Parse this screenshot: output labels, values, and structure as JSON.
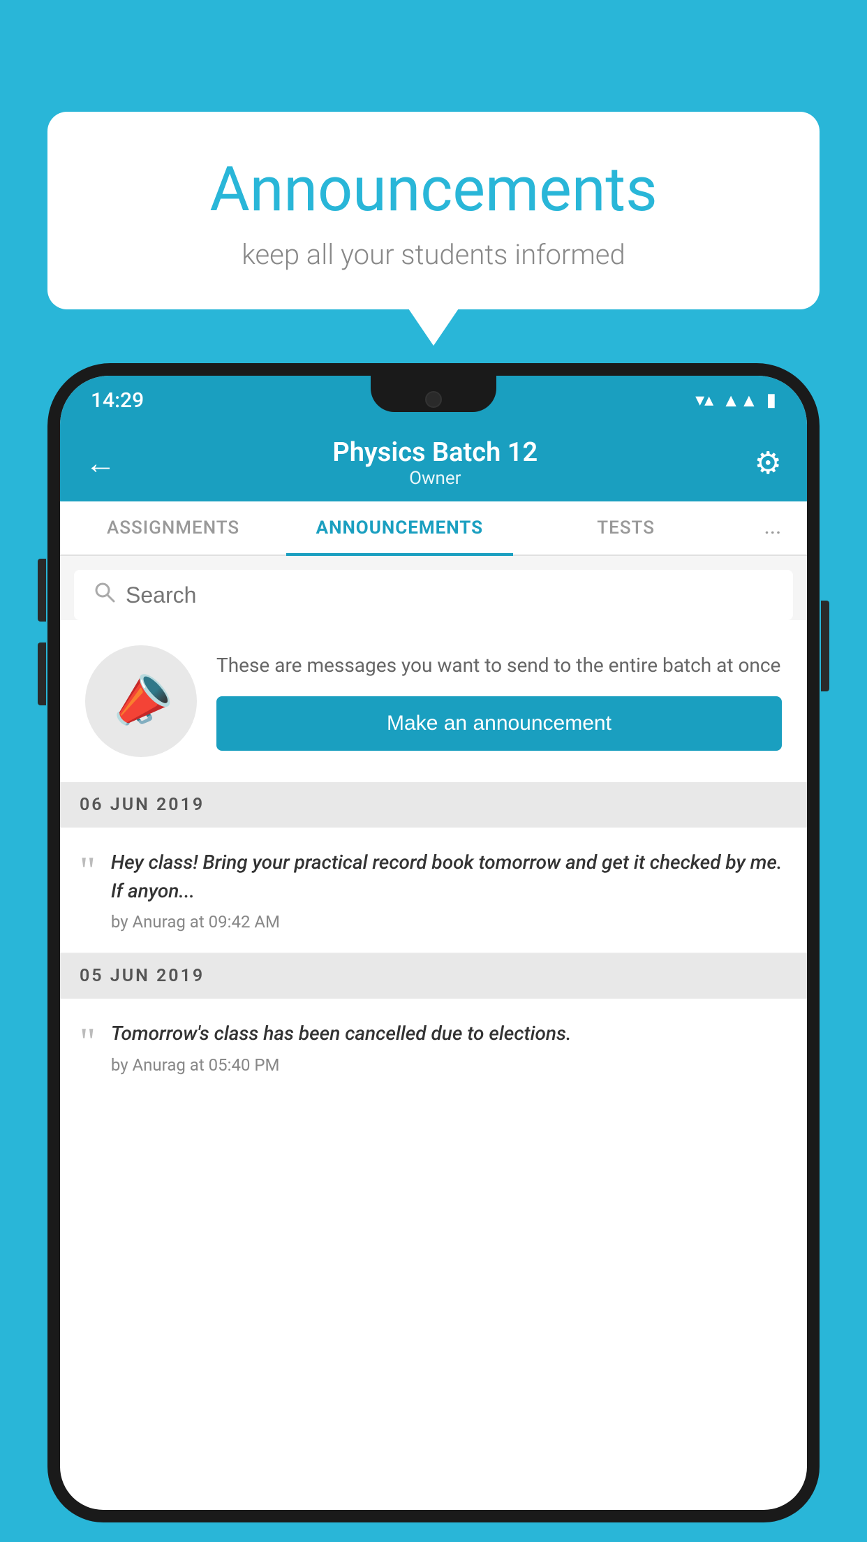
{
  "background_color": "#29b6d8",
  "bubble": {
    "title": "Announcements",
    "subtitle": "keep all your students informed"
  },
  "status_bar": {
    "time": "14:29",
    "icons": [
      "wifi",
      "signal",
      "battery"
    ]
  },
  "header": {
    "back_label": "←",
    "title": "Physics Batch 12",
    "subtitle": "Owner",
    "settings_label": "⚙"
  },
  "tabs": [
    {
      "label": "ASSIGNMENTS",
      "active": false
    },
    {
      "label": "ANNOUNCEMENTS",
      "active": true
    },
    {
      "label": "TESTS",
      "active": false
    },
    {
      "label": "...",
      "active": false
    }
  ],
  "search": {
    "placeholder": "Search"
  },
  "announcement_prompt": {
    "description": "These are messages you want to send to the entire batch at once",
    "button_label": "Make an announcement"
  },
  "date_1": "06  JUN  2019",
  "announcement_1": {
    "text": "Hey class! Bring your practical record book tomorrow and get it checked by me. If anyon...",
    "meta": "by Anurag at 09:42 AM"
  },
  "date_2": "05  JUN  2019",
  "announcement_2": {
    "text": "Tomorrow's class has been cancelled due to elections.",
    "meta": "by Anurag at 05:40 PM"
  }
}
